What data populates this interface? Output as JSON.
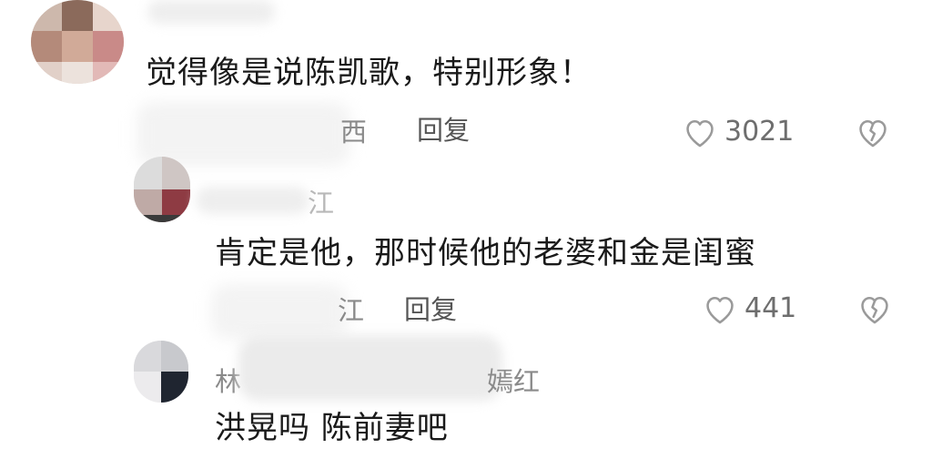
{
  "colors": {
    "icon_gray": "#9a9a9a",
    "meta_gray": "#8a8a8a"
  },
  "comments": [
    {
      "author_visible": "",
      "text": "觉得像是说陈凯歌，特别形象！",
      "meta_visible": "西",
      "reply_label": "回复",
      "like_count": "3021"
    },
    {
      "author_visible": "江",
      "text": "肯定是他，那时候他的老婆和金是闺蜜",
      "meta_visible": "江",
      "reply_label": "回复",
      "like_count": "441"
    },
    {
      "author_visible_start": "林",
      "author_visible_end": "嫣红",
      "text": "洪晃吗 陈前妻吧"
    }
  ]
}
